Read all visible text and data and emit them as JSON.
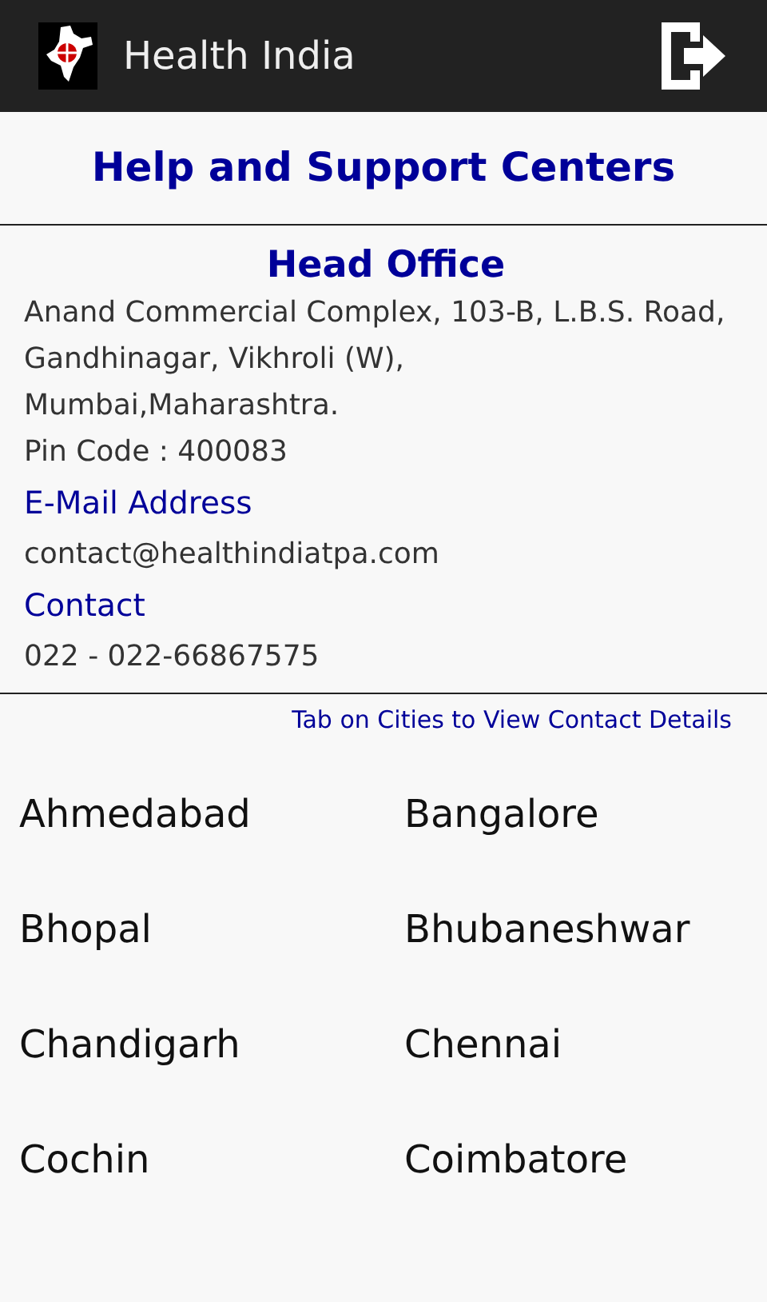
{
  "app_bar": {
    "title": "Health India"
  },
  "page_title": "Help and Support Centers",
  "head_office": {
    "heading": "Head Office",
    "address_lines": [
      "Anand Commercial Complex, 103-B, L.B.S. Road,",
      "Gandhinagar, Vikhroli (W),",
      "Mumbai,Maharashtra.",
      "Pin Code : 400083"
    ],
    "email_label": "E-Mail Address",
    "email": "contact@healthindiatpa.com",
    "contact_label": "Contact",
    "contact": "022 - 022-66867575"
  },
  "hint": "Tab on Cities to View Contact Details",
  "cities": [
    "Ahmedabad",
    "Bangalore",
    "Bhopal",
    "Bhubaneshwar",
    "Chandigarh",
    "Chennai",
    "Cochin",
    "Coimbatore"
  ]
}
